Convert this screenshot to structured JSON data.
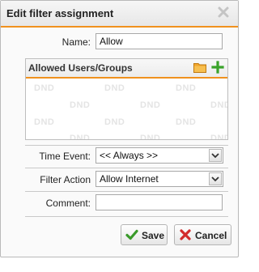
{
  "dialog": {
    "title": "Edit filter assignment",
    "close_icon": "close-icon"
  },
  "fields": {
    "name_label": "Name:",
    "name_value": "Allow",
    "time_event_label": "Time Event:",
    "time_event_value": "<< Always >>",
    "filter_action_label": "Filter Action",
    "filter_action_value": "Allow Internet",
    "comment_label": "Comment:",
    "comment_value": ""
  },
  "users_groups": {
    "title": "Allowed Users/Groups",
    "folder_icon": "folder-icon",
    "add_icon": "plus-icon",
    "watermark": "DND"
  },
  "buttons": {
    "save_label": "Save",
    "save_icon": "checkmark-icon",
    "cancel_label": "Cancel",
    "cancel_icon": "x-icon"
  },
  "colors": {
    "accent": "#f0911e",
    "save_icon": "#3a9a2a",
    "cancel_icon": "#d22b2b",
    "add_icon": "#3aa32a",
    "folder_icon": "#f0a52c"
  }
}
